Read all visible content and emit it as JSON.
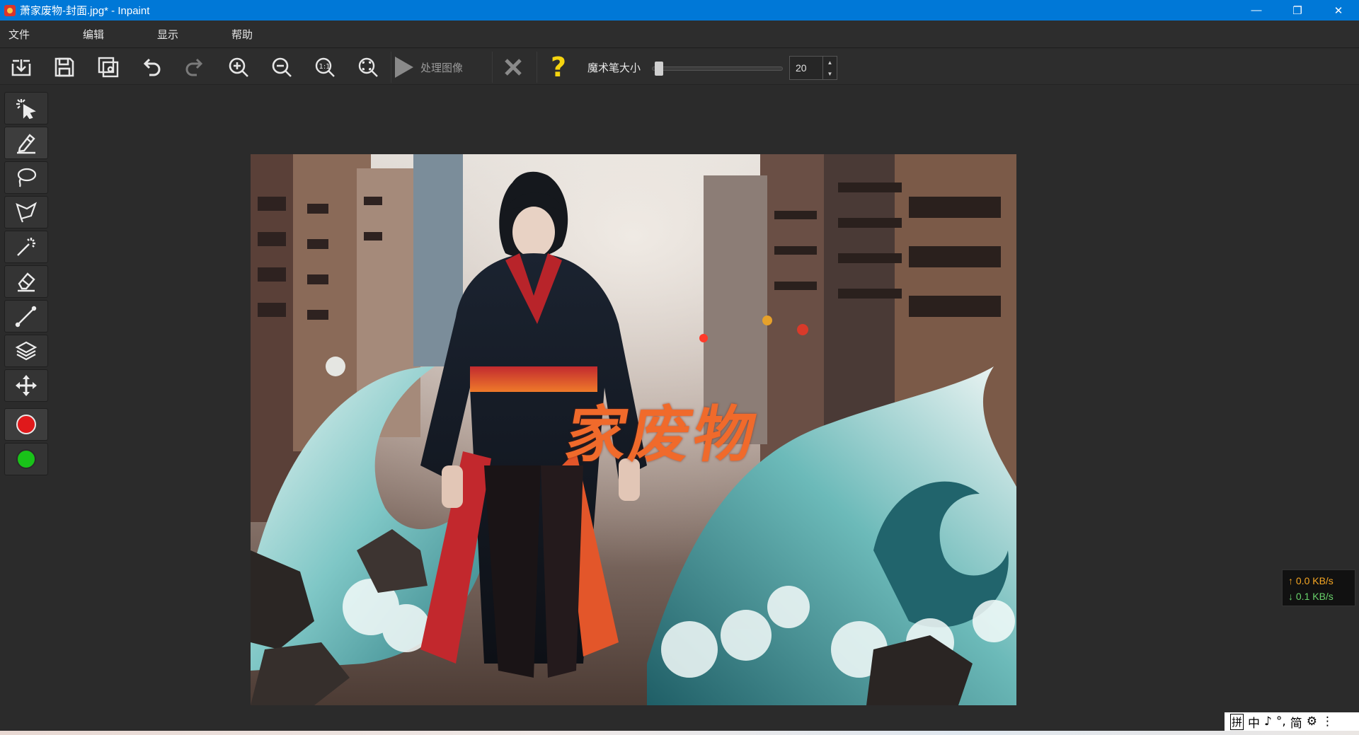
{
  "window": {
    "title": "萧家废物-封面.jpg* - Inpaint",
    "controls": {
      "minimize": "—",
      "maximize": "❐",
      "close": "✕"
    }
  },
  "menu": {
    "items": [
      "文件",
      "编辑",
      "显示",
      "帮助"
    ]
  },
  "toolbar": {
    "process_label": "处理图像",
    "brush_size_label": "魔术笔大小",
    "brush_size_value": "20",
    "brush_slider_fraction": 0.02,
    "help_glyph": "?",
    "icons": [
      "open-icon",
      "save-icon",
      "save-as-icon",
      "undo-icon",
      "redo-icon",
      "zoom-in-icon",
      "zoom-out-icon",
      "zoom-1to1-icon",
      "zoom-fit-icon",
      "play-icon",
      "cancel-icon",
      "help-icon"
    ],
    "colors": {
      "help": "#f5d40f",
      "cancel": "#8a8a8a"
    }
  },
  "tools": {
    "items": [
      "selection-icon",
      "marker-icon",
      "lasso-icon",
      "polygon-lasso-icon",
      "magic-wand-icon",
      "eraser-icon",
      "line-icon",
      "layers-icon",
      "move-icon",
      "red-color",
      "green-color"
    ],
    "colors": {
      "red": "#e0191b",
      "green": "#19c219"
    }
  },
  "canvas": {
    "overlay_text": "家废物",
    "overlay_color": "#f06a2b"
  },
  "netspeed": {
    "up": "↑ 0.0 KB/s",
    "down": "↓ 0.1 KB/s"
  },
  "ime": {
    "glyphs": [
      "拼",
      "中",
      "♪",
      "°,",
      "简",
      "⚙",
      "⋮"
    ]
  }
}
